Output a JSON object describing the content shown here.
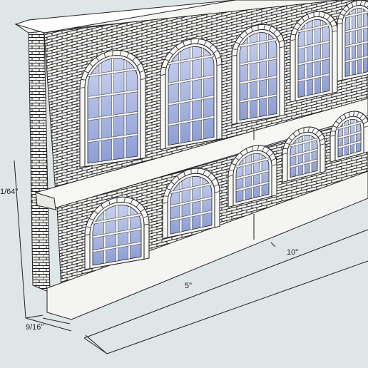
{
  "viewport": {
    "title": "",
    "background": "#dfe6e8",
    "model": {
      "subject": "brick-facade",
      "wall_color": "#f2f2f0",
      "brick_line_color": "#222222",
      "glass_color": "#aebbe3",
      "window_frame_color": "#f5f5f5"
    }
  },
  "dimensions": {
    "height_label": "1/64\"",
    "depth_label": "9/16\"",
    "half_length_label": "5\"",
    "length_label": "10\""
  }
}
